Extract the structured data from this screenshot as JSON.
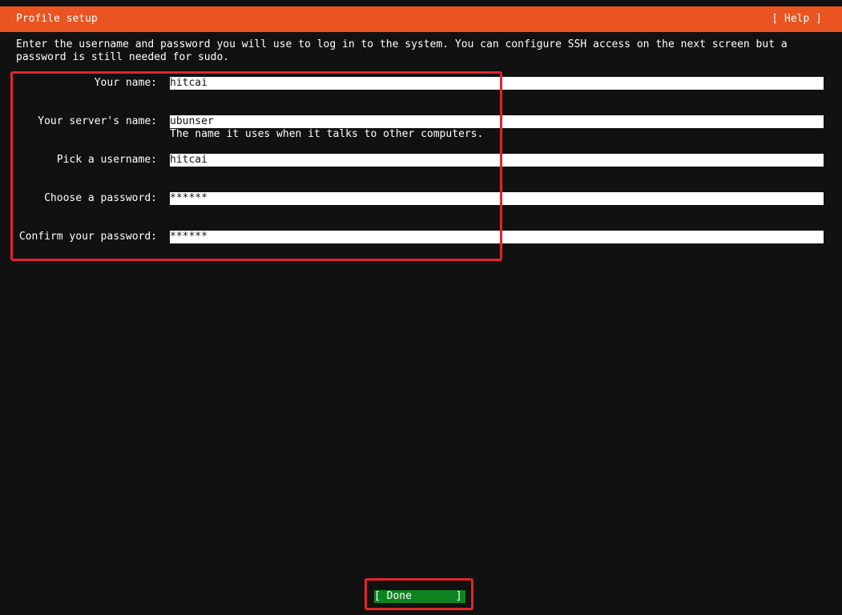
{
  "header": {
    "title": "Profile setup",
    "help_label": "[ Help ]"
  },
  "intro": "Enter the username and password you will use to log in to the system. You can configure SSH access on the next screen but a password is still needed for sudo.",
  "form": {
    "your_name": {
      "label": "Your name:",
      "value": "hitcai"
    },
    "server_name": {
      "label": "Your server's name:",
      "value": "ubunser",
      "hint": "The name it uses when it talks to other computers."
    },
    "username": {
      "label": "Pick a username:",
      "value": "hitcai"
    },
    "password": {
      "label": "Choose a password:",
      "value": "******"
    },
    "confirm_password": {
      "label": "Confirm your password:",
      "value": "******"
    }
  },
  "done_button": {
    "label": "[ Done       ]"
  },
  "colors": {
    "header_bg": "#e95420",
    "background": "#111111",
    "done_bg": "#0e8420",
    "highlight": "#e3242b"
  }
}
